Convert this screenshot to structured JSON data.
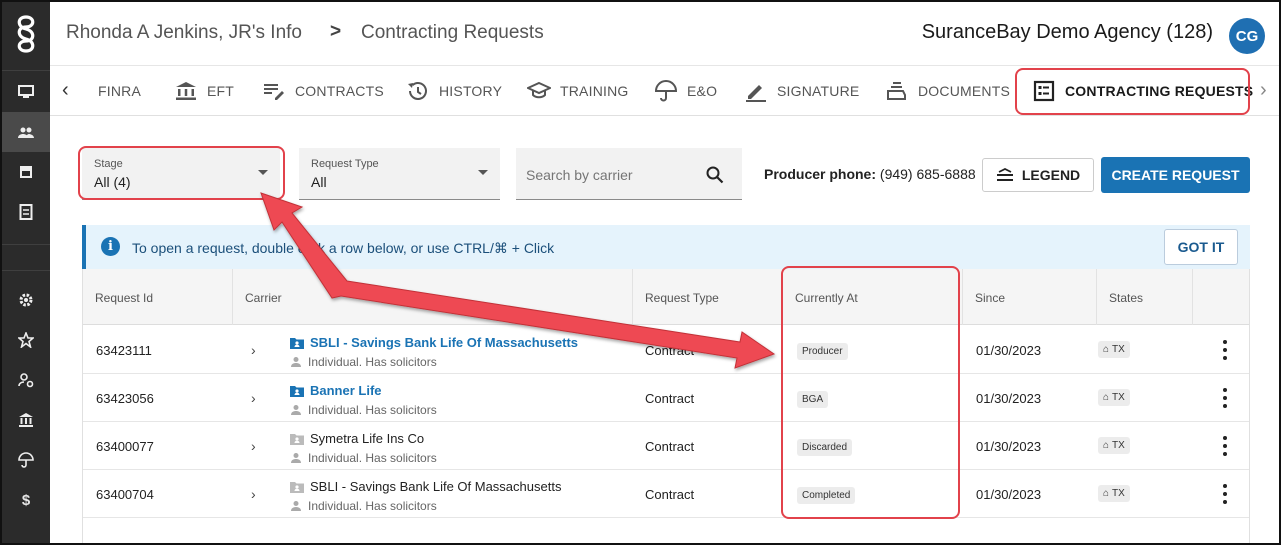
{
  "header": {
    "breadcrumb_person": "Rhonda A Jenkins, JR's Info",
    "breadcrumb_sep": ">",
    "breadcrumb_page": "Contracting Requests",
    "agency": "SuranceBay Demo Agency (128)",
    "avatar_initials": "CG"
  },
  "sidebar": {
    "items": [
      {
        "icon": "monitor-icon"
      },
      {
        "icon": "people-icon"
      },
      {
        "icon": "store-icon"
      },
      {
        "icon": "document-icon"
      },
      {
        "icon": "gear-icon"
      },
      {
        "icon": "badge-star-icon"
      },
      {
        "icon": "user-settings-icon"
      },
      {
        "icon": "bank-icon"
      },
      {
        "icon": "umbrella-icon"
      },
      {
        "icon": "dollar-icon",
        "glyph": "$"
      }
    ]
  },
  "tabs": [
    {
      "label": "FINRA",
      "icon": "finra"
    },
    {
      "label": "EFT",
      "icon": "bank-icon"
    },
    {
      "label": "CONTRACTS",
      "icon": "contract-edit-icon"
    },
    {
      "label": "HISTORY",
      "icon": "history-icon"
    },
    {
      "label": "TRAINING",
      "icon": "graduation-cap-icon"
    },
    {
      "label": "E&O",
      "icon": "umbrella-icon"
    },
    {
      "label": "SIGNATURE",
      "icon": "pen-icon"
    },
    {
      "label": "DOCUMENTS",
      "icon": "documents-icon"
    },
    {
      "label": "CONTRACTING REQUESTS",
      "icon": "list-box-icon",
      "active": true
    }
  ],
  "filters": {
    "stage_label": "Stage",
    "stage_value": "All (4)",
    "request_type_label": "Request Type",
    "request_type_value": "All",
    "search_placeholder": "Search by carrier",
    "phone_label": "Producer phone:",
    "phone_value": "(949) 685-6888",
    "legend_label": "LEGEND",
    "create_label": "CREATE REQUEST"
  },
  "banner": {
    "text": "To open a request, double click a row below, or use CTRL/⌘ + Click",
    "button": "GOT IT"
  },
  "table": {
    "columns": [
      "Request Id",
      "Carrier",
      "Request Type",
      "Currently At",
      "Since",
      "States"
    ],
    "rows": [
      {
        "id": "63423111",
        "carrier": "SBLI - Savings Bank Life Of Massachusetts",
        "carrier_link": true,
        "sub": "Individual. Has solicitors",
        "type": "Contract",
        "at": "Producer",
        "since": "01/30/2023",
        "state": "TX"
      },
      {
        "id": "63423056",
        "carrier": "Banner Life",
        "carrier_link": true,
        "sub": "Individual. Has solicitors",
        "type": "Contract",
        "at": "BGA",
        "since": "01/30/2023",
        "state": "TX"
      },
      {
        "id": "63400077",
        "carrier": "Symetra Life Ins Co",
        "carrier_link": false,
        "sub": "Individual. Has solicitors",
        "type": "Contract",
        "at": "Discarded",
        "since": "01/30/2023",
        "state": "TX"
      },
      {
        "id": "63400704",
        "carrier": "SBLI - Savings Bank Life Of Massachusetts",
        "carrier_link": false,
        "sub": "Individual. Has solicitors",
        "type": "Contract",
        "at": "Completed",
        "since": "01/30/2023",
        "state": "TX"
      }
    ]
  },
  "colors": {
    "accent": "#1a73b4",
    "annotation": "#e2424b",
    "sidebar": "#2b2b2b"
  }
}
